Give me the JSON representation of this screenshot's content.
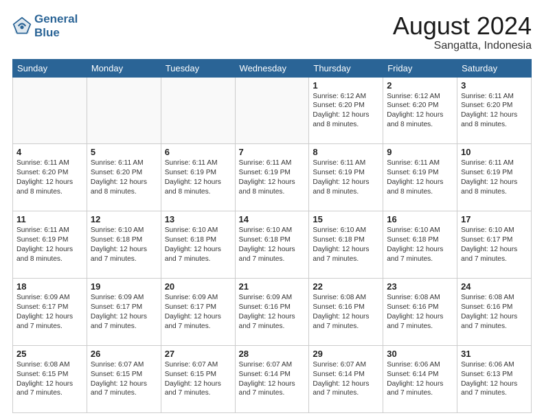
{
  "header": {
    "logo_line1": "General",
    "logo_line2": "Blue",
    "month_year": "August 2024",
    "location": "Sangatta, Indonesia"
  },
  "weekdays": [
    "Sunday",
    "Monday",
    "Tuesday",
    "Wednesday",
    "Thursday",
    "Friday",
    "Saturday"
  ],
  "weeks": [
    [
      {
        "day": "",
        "text": ""
      },
      {
        "day": "",
        "text": ""
      },
      {
        "day": "",
        "text": ""
      },
      {
        "day": "",
        "text": ""
      },
      {
        "day": "1",
        "text": "Sunrise: 6:12 AM\nSunset: 6:20 PM\nDaylight: 12 hours and 8 minutes."
      },
      {
        "day": "2",
        "text": "Sunrise: 6:12 AM\nSunset: 6:20 PM\nDaylight: 12 hours and 8 minutes."
      },
      {
        "day": "3",
        "text": "Sunrise: 6:11 AM\nSunset: 6:20 PM\nDaylight: 12 hours and 8 minutes."
      }
    ],
    [
      {
        "day": "4",
        "text": "Sunrise: 6:11 AM\nSunset: 6:20 PM\nDaylight: 12 hours and 8 minutes."
      },
      {
        "day": "5",
        "text": "Sunrise: 6:11 AM\nSunset: 6:20 PM\nDaylight: 12 hours and 8 minutes."
      },
      {
        "day": "6",
        "text": "Sunrise: 6:11 AM\nSunset: 6:19 PM\nDaylight: 12 hours and 8 minutes."
      },
      {
        "day": "7",
        "text": "Sunrise: 6:11 AM\nSunset: 6:19 PM\nDaylight: 12 hours and 8 minutes."
      },
      {
        "day": "8",
        "text": "Sunrise: 6:11 AM\nSunset: 6:19 PM\nDaylight: 12 hours and 8 minutes."
      },
      {
        "day": "9",
        "text": "Sunrise: 6:11 AM\nSunset: 6:19 PM\nDaylight: 12 hours and 8 minutes."
      },
      {
        "day": "10",
        "text": "Sunrise: 6:11 AM\nSunset: 6:19 PM\nDaylight: 12 hours and 8 minutes."
      }
    ],
    [
      {
        "day": "11",
        "text": "Sunrise: 6:11 AM\nSunset: 6:19 PM\nDaylight: 12 hours and 8 minutes."
      },
      {
        "day": "12",
        "text": "Sunrise: 6:10 AM\nSunset: 6:18 PM\nDaylight: 12 hours and 7 minutes."
      },
      {
        "day": "13",
        "text": "Sunrise: 6:10 AM\nSunset: 6:18 PM\nDaylight: 12 hours and 7 minutes."
      },
      {
        "day": "14",
        "text": "Sunrise: 6:10 AM\nSunset: 6:18 PM\nDaylight: 12 hours and 7 minutes."
      },
      {
        "day": "15",
        "text": "Sunrise: 6:10 AM\nSunset: 6:18 PM\nDaylight: 12 hours and 7 minutes."
      },
      {
        "day": "16",
        "text": "Sunrise: 6:10 AM\nSunset: 6:18 PM\nDaylight: 12 hours and 7 minutes."
      },
      {
        "day": "17",
        "text": "Sunrise: 6:10 AM\nSunset: 6:17 PM\nDaylight: 12 hours and 7 minutes."
      }
    ],
    [
      {
        "day": "18",
        "text": "Sunrise: 6:09 AM\nSunset: 6:17 PM\nDaylight: 12 hours and 7 minutes."
      },
      {
        "day": "19",
        "text": "Sunrise: 6:09 AM\nSunset: 6:17 PM\nDaylight: 12 hours and 7 minutes."
      },
      {
        "day": "20",
        "text": "Sunrise: 6:09 AM\nSunset: 6:17 PM\nDaylight: 12 hours and 7 minutes."
      },
      {
        "day": "21",
        "text": "Sunrise: 6:09 AM\nSunset: 6:16 PM\nDaylight: 12 hours and 7 minutes."
      },
      {
        "day": "22",
        "text": "Sunrise: 6:08 AM\nSunset: 6:16 PM\nDaylight: 12 hours and 7 minutes."
      },
      {
        "day": "23",
        "text": "Sunrise: 6:08 AM\nSunset: 6:16 PM\nDaylight: 12 hours and 7 minutes."
      },
      {
        "day": "24",
        "text": "Sunrise: 6:08 AM\nSunset: 6:16 PM\nDaylight: 12 hours and 7 minutes."
      }
    ],
    [
      {
        "day": "25",
        "text": "Sunrise: 6:08 AM\nSunset: 6:15 PM\nDaylight: 12 hours and 7 minutes."
      },
      {
        "day": "26",
        "text": "Sunrise: 6:07 AM\nSunset: 6:15 PM\nDaylight: 12 hours and 7 minutes."
      },
      {
        "day": "27",
        "text": "Sunrise: 6:07 AM\nSunset: 6:15 PM\nDaylight: 12 hours and 7 minutes."
      },
      {
        "day": "28",
        "text": "Sunrise: 6:07 AM\nSunset: 6:14 PM\nDaylight: 12 hours and 7 minutes."
      },
      {
        "day": "29",
        "text": "Sunrise: 6:07 AM\nSunset: 6:14 PM\nDaylight: 12 hours and 7 minutes."
      },
      {
        "day": "30",
        "text": "Sunrise: 6:06 AM\nSunset: 6:14 PM\nDaylight: 12 hours and 7 minutes."
      },
      {
        "day": "31",
        "text": "Sunrise: 6:06 AM\nSunset: 6:13 PM\nDaylight: 12 hours and 7 minutes."
      }
    ]
  ]
}
